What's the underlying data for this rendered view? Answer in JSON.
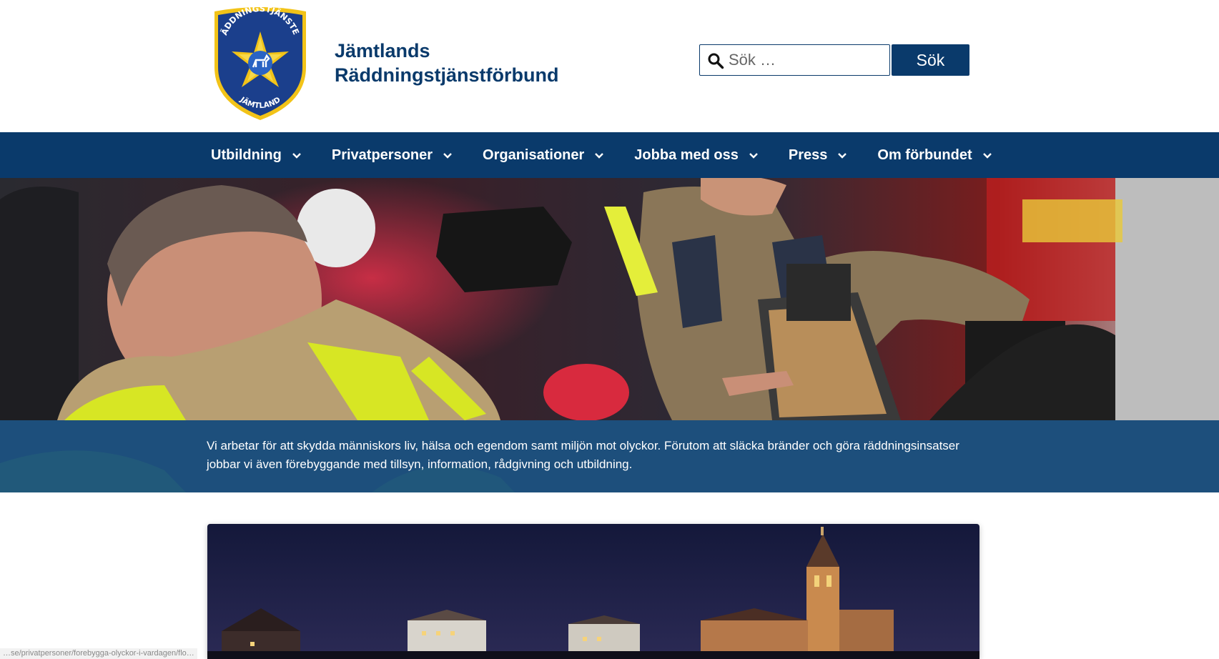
{
  "header": {
    "brand_line1": "Jämtlands",
    "brand_line2": "Räddningstjänstförbund",
    "logo": {
      "top_text": "RÄDDNINGSTJÄNSTEN",
      "bottom_text": "JÄMTLAND",
      "icon": "shield-badge-icon"
    }
  },
  "search": {
    "placeholder": "Sök …",
    "button_label": "Sök",
    "icon": "search-icon"
  },
  "nav": {
    "items": [
      {
        "label": "Utbildning"
      },
      {
        "label": "Privatpersoner"
      },
      {
        "label": "Organisationer"
      },
      {
        "label": "Jobba med oss"
      },
      {
        "label": "Press"
      },
      {
        "label": "Om förbundet"
      }
    ]
  },
  "hero": {
    "caption": "Vi arbetar för att skydda människors liv, hälsa och egendom samt miljön mot olyckor. Förutom att släcka bränder och göra räddningsinsatser jobbar vi även förebyggande med tillsyn, information, rådgivning och utbildning."
  },
  "status_bar": {
    "url": "…se/privatpersoner/forebygga-olyckor-i-vardagen/flo…"
  },
  "colors": {
    "primary": "#0a3a6b",
    "caption_band": "#1d4f7c",
    "logo_blue": "#1b3f8c",
    "logo_gold": "#f2c318"
  }
}
